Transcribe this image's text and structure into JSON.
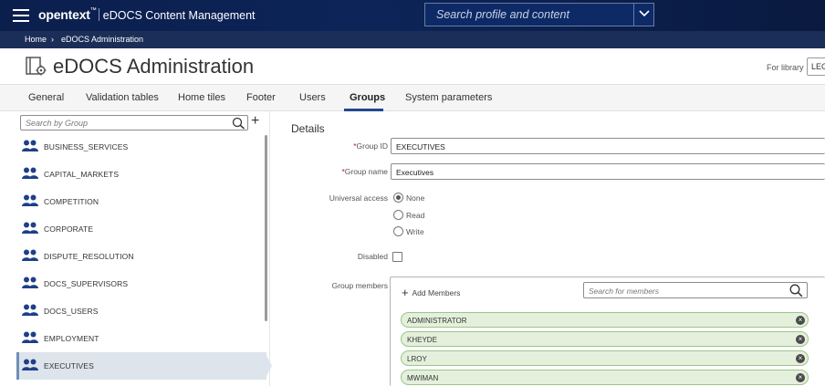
{
  "header": {
    "brand": "opentext",
    "brand_tm": "™",
    "app_name": "eDOCS Content Management",
    "search_placeholder": "Search profile and content"
  },
  "breadcrumb": {
    "home": "Home",
    "separator": "›",
    "current": "eDOCS Administration"
  },
  "page": {
    "title": "eDOCS Administration",
    "for_library_label": "For library",
    "library_value": "LEG"
  },
  "tabs": [
    {
      "label": "General"
    },
    {
      "label": "Validation tables"
    },
    {
      "label": "Home tiles"
    },
    {
      "label": "Footer"
    },
    {
      "label": "Users"
    },
    {
      "label": "Groups",
      "active": true
    },
    {
      "label": "System parameters"
    }
  ],
  "groups": {
    "search_placeholder": "Search by Group",
    "items": [
      {
        "name": "BUSINESS_SERVICES"
      },
      {
        "name": "CAPITAL_MARKETS"
      },
      {
        "name": "COMPETITION"
      },
      {
        "name": "CORPORATE"
      },
      {
        "name": "DISPUTE_RESOLUTION"
      },
      {
        "name": "DOCS_SUPERVISORS"
      },
      {
        "name": "DOCS_USERS"
      },
      {
        "name": "EMPLOYMENT"
      },
      {
        "name": "EXECUTIVES",
        "selected": true
      }
    ]
  },
  "details": {
    "title": "Details",
    "required_mark": "*",
    "group_id_label": "Group ID",
    "group_id_value": "EXECUTIVES",
    "group_name_label": "Group name",
    "group_name_value": "Executives",
    "universal_access_label": "Universal access",
    "access_options": [
      "None",
      "Read",
      "Write"
    ],
    "access_selected": "None",
    "disabled_label": "Disabled",
    "disabled_checked": false,
    "members_label": "Group members",
    "add_members_label": "Add Members",
    "members_search_placeholder": "Search for members",
    "members": [
      "ADMINISTRATOR",
      "KHEYDE",
      "LROY",
      "MWIMAN"
    ]
  },
  "colors": {
    "header_bg": "#0b1f4d",
    "accent": "#23478f",
    "group_icon": "#1f3f86",
    "chip_bg": "#e4f0dc",
    "chip_border": "#9cc58a",
    "required": "#c8102e"
  }
}
